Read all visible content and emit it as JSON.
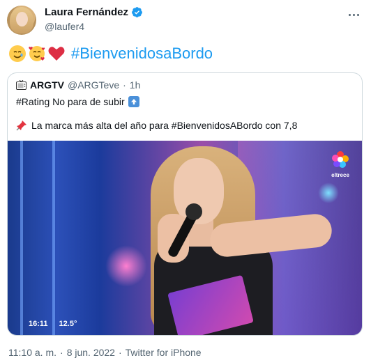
{
  "author": {
    "name": "Laura Fernández",
    "handle": "@laufer4"
  },
  "tweet": {
    "emojis": [
      "smiling-face-with-tear",
      "smiling-face-with-hearts",
      "red-heart"
    ],
    "hashtag": "#BienvenidosaBordo"
  },
  "quoted": {
    "name": "ARGTV",
    "handle": "@ARGTeve",
    "separator": "·",
    "age": "1h",
    "line1": "#Rating No para de subir",
    "line2": "La marca más alta del año para #BienvenidosABordo con 7,8"
  },
  "media": {
    "channel_logo_text": "eltrece",
    "osd_time": "16:11",
    "osd_temp": "12.5°"
  },
  "footer": {
    "time": "11:10 a. m.",
    "sep1": "·",
    "date": "8 jun. 2022",
    "sep2": "·",
    "source": "Twitter for iPhone"
  },
  "colors": {
    "link": "#1d9bf0",
    "muted": "#536471",
    "verified": "#1d9bf0"
  }
}
